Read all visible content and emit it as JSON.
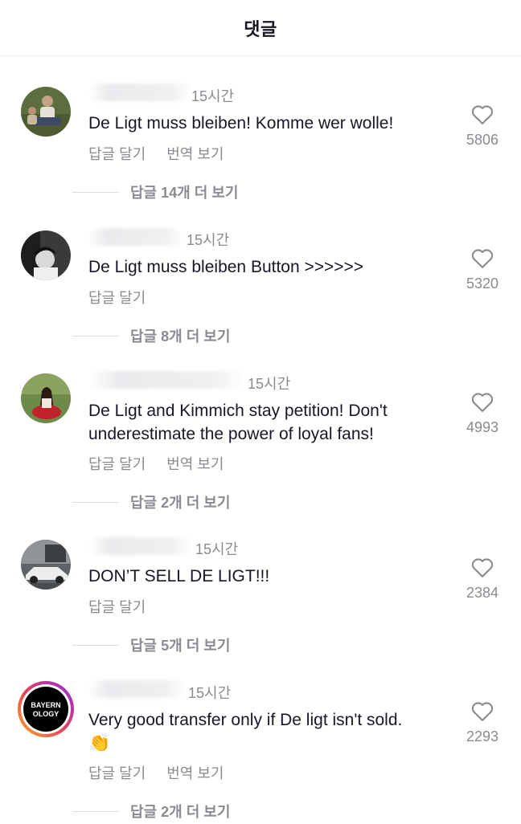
{
  "header": {
    "title": "댓글"
  },
  "comments": [
    {
      "time": "15시간",
      "text": "De Ligt muss bleiben! Komme wer wolle!",
      "actions": [
        "답글 달기",
        "번역 보기"
      ],
      "replies": "답글 14개 더 보기",
      "likes": "5806",
      "avatar_colors": [
        "#5d6e3e",
        "#c4b29a"
      ]
    },
    {
      "time": "15시간",
      "text": "De Ligt muss bleiben Button >>>>>>",
      "actions": [
        "답글 달기"
      ],
      "replies": "답글 8개 더 보기",
      "likes": "5320",
      "avatar_colors": [
        "#2b2b2b",
        "#d8d8d8"
      ]
    },
    {
      "time": "15시간",
      "text": "De Ligt and Kimmich stay petition! Don't underestimate the power of loyal fans!",
      "actions": [
        "답글 달기",
        "번역 보기"
      ],
      "replies": "답글 2개 더 보기",
      "likes": "4993",
      "avatar_colors": [
        "#6e8a4a",
        "#c2232b"
      ]
    },
    {
      "time": "15시간",
      "text": "DON’T SELL DE LIGT!!!",
      "actions": [
        "답글 달기"
      ],
      "replies": "답글 5개 더 보기",
      "likes": "2384",
      "avatar_colors": [
        "#6b6f72",
        "#e9e9e9"
      ]
    },
    {
      "time": "15시간",
      "text": "Very good transfer only if De ligt isn't sold.",
      "emoji": "👏",
      "actions": [
        "답글 달기",
        "번역 보기"
      ],
      "replies": "답글 2개 더 보기",
      "likes": "2293",
      "avatar_logo": "BAYERN OLOGY",
      "avatar_colors": [
        "#000000",
        "#e4405f"
      ]
    }
  ],
  "icons": {
    "like": "heart-outline-icon"
  },
  "colors": {
    "text": "#161823",
    "secondary": "#8a8b91",
    "divider": "#dcdcdc"
  }
}
